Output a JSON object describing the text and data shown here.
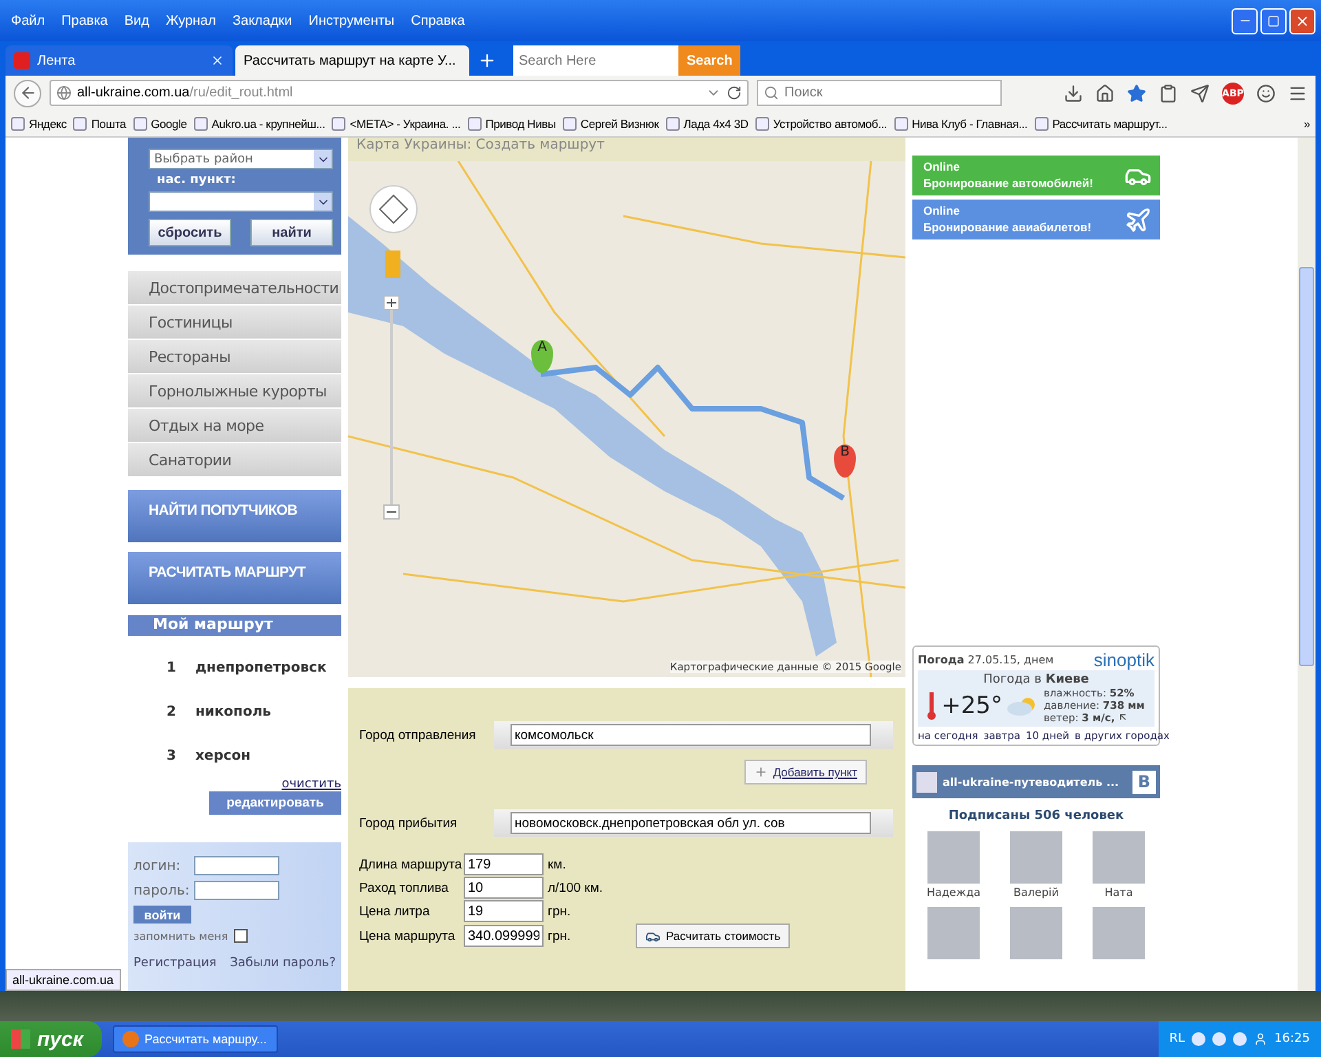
{
  "menu": [
    "Файл",
    "Правка",
    "Вид",
    "Журнал",
    "Закладки",
    "Инструменты",
    "Справка"
  ],
  "tabs": [
    {
      "label": "Лента",
      "selected": false
    },
    {
      "label": "Рассчитать маршрут на карте У...",
      "selected": true
    }
  ],
  "tab_search": {
    "placeholder": "Search Here",
    "button": "Search"
  },
  "address": {
    "host": "all-ukraine.com.ua",
    "path": "/ru/edit_rout.html"
  },
  "search": {
    "placeholder": "Поиск"
  },
  "adblock_badge": "ABP",
  "bookmarks": [
    "Яндекс",
    "Пошта",
    "Google",
    "Aukro.ua - крупнейш...",
    "<META> - Украина. ...",
    "Привод Нивы",
    "Сергей Визнюк",
    "Лада 4х4 3D",
    "Устройство автомоб...",
    "Нива Клуб - Главная...",
    "Рассчитать маршрут..."
  ],
  "bookmarks_more": "»",
  "sidebar": {
    "district_select": "Выбрать район",
    "place_label": "нас. пункт:",
    "reset_button": "сбросить",
    "find_button": "найти",
    "categories": [
      "Достопримечательности",
      "Гостиницы",
      "Рестораны",
      "Горнолыжные курорты",
      "Отдых на море",
      "Санатории"
    ],
    "big_buttons": [
      "НАЙТИ ПОПУТЧИКОВ",
      "РАСЧИТАТЬ МАРШРУТ"
    ],
    "route_title": "Мой маршрут",
    "route": [
      {
        "number": "1",
        "city": "днепропетровск"
      },
      {
        "number": "2",
        "city": "никополь"
      },
      {
        "number": "3",
        "city": "херсон"
      }
    ],
    "clear_link": "очистить",
    "edit_button": "редактировать",
    "login": {
      "login_label": "логин:",
      "password_label": "пароль:",
      "submit": "войти",
      "remember_label": "запомнить меня",
      "remember_checked": false,
      "register_link": "Регистрация",
      "forgot_link": "Забыли пароль?"
    }
  },
  "map": {
    "title": "Карта Украины: Создать маршрут",
    "markers": [
      "A",
      "B"
    ],
    "attribution": "Картографические данные © 2015 Google"
  },
  "form": {
    "from_label": "Город отправления",
    "from_value": "комсомольск",
    "add_point": "Добавить пункт",
    "to_label": "Город прибытия",
    "to_value": "новомосковск.днепропетровская обл ул. сов",
    "rows": [
      {
        "label": "Длина маршрута",
        "value": "179",
        "unit": "км."
      },
      {
        "label": "Раход топлива",
        "value": "10",
        "unit": "л/100 км."
      },
      {
        "label": "Цена литра",
        "value": "19",
        "unit": "грн."
      },
      {
        "label": "Цена маршрута",
        "value": "340.099999",
        "unit": "грн."
      }
    ],
    "calc_button": "Расчитать стоимость"
  },
  "promos": [
    {
      "kind": "car",
      "line1": "Online",
      "line2": "Бронирование автомобилей!",
      "color": "#4db848"
    },
    {
      "kind": "plane",
      "line1": "Online",
      "line2": "Бронирование авиабилетов!",
      "color": "#5b8fe0"
    }
  ],
  "weather": {
    "heading": "**Погода** 27.05.15, днем",
    "logo": "sinoptik",
    "city": "Погода в **Киеве**",
    "temperature": "+25°",
    "humidity": "влажность: **52%**",
    "pressure": "давление: **738 мм**",
    "wind": "ветер: **3 м/с,**",
    "links": [
      "на сегодня",
      "завтра",
      "10 дней",
      "в других городах"
    ]
  },
  "vk": {
    "title": "all-ukraine-путеводитель ...",
    "logo": "В",
    "subscribers": "Подписаны 506 человек",
    "people": [
      "Надежда",
      "Валерій",
      "Ната"
    ]
  },
  "status_url": "all-ukraine.com.ua",
  "taskbar": {
    "start": "пуск",
    "task": "Рассчитать маршру...",
    "lang": "RL",
    "clock": "16:25"
  }
}
